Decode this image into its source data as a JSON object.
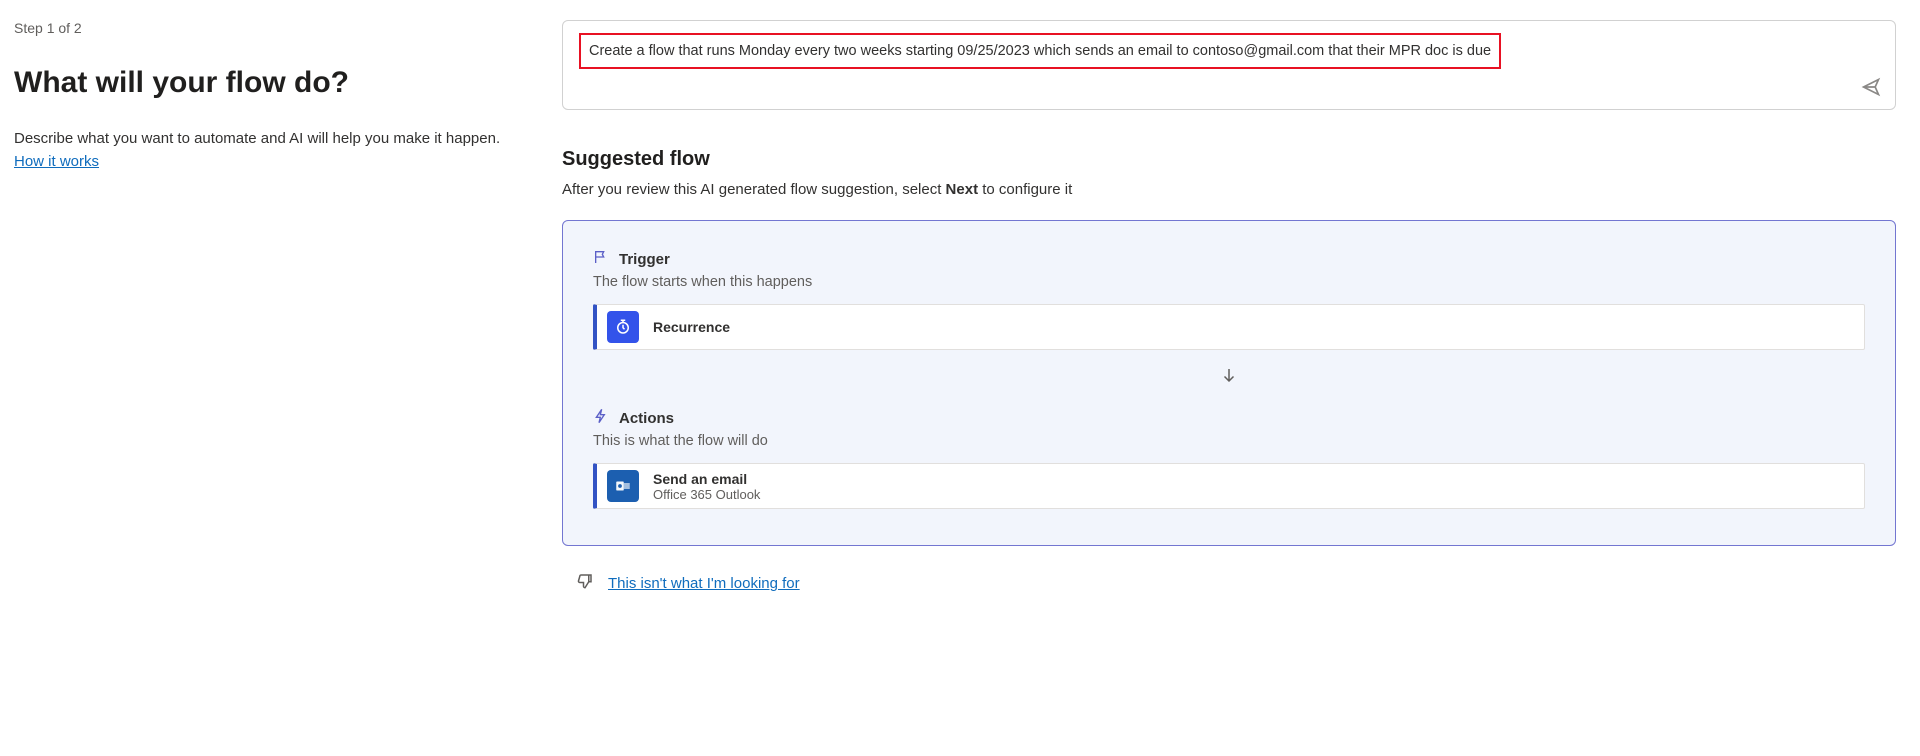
{
  "left": {
    "step_label": "Step 1 of 2",
    "heading": "What will your flow do?",
    "description": "Describe what you want to automate and AI will help you make it happen.",
    "how_it_works": "How it works"
  },
  "prompt": {
    "text": "Create a flow that runs Monday every two weeks starting 09/25/2023 which sends an email to contoso@gmail.com that their MPR doc is due"
  },
  "suggested": {
    "heading": "Suggested flow",
    "sub_prefix": "After you review this AI generated flow suggestion, select ",
    "sub_bold": "Next",
    "sub_suffix": " to configure it",
    "trigger_label": "Trigger",
    "trigger_sub": "The flow starts when this happens",
    "trigger_step_title": "Recurrence",
    "actions_label": "Actions",
    "actions_sub": "This is what the flow will do",
    "action_step_title": "Send an email",
    "action_step_sub": "Office 365 Outlook"
  },
  "feedback": {
    "not_looking": "This isn't what I'm looking for"
  }
}
